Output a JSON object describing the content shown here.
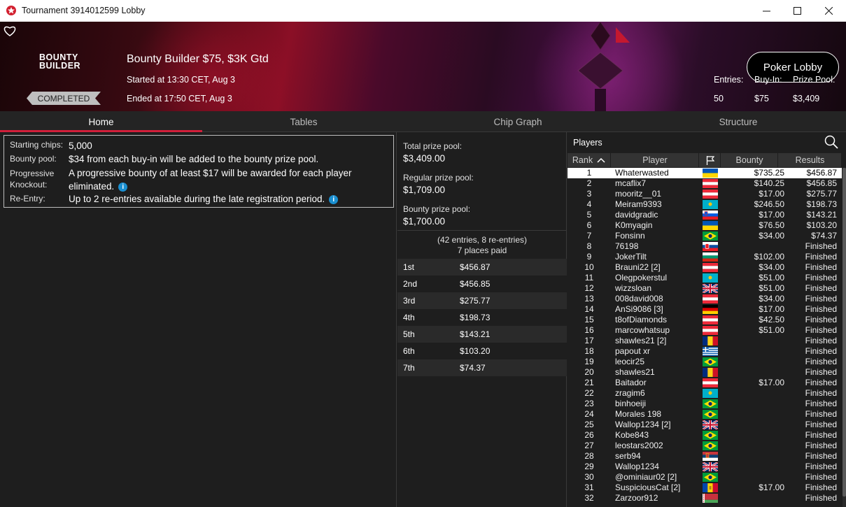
{
  "window": {
    "title": "Tournament 3914012599 Lobby"
  },
  "header": {
    "brand": "BOUNTY BUILDER",
    "name": "Bounty Builder $75, $3K Gtd",
    "started": "Started at 13:30 CET, Aug 3",
    "ended": "Ended at 17:50 CET, Aug 3",
    "status": "COMPLETED",
    "lobby_button": "Poker Lobby",
    "entries_label": "Entries:",
    "entries": "50",
    "buyin_label": "Buy-In:",
    "buyin": "$75",
    "pool_label": "Prize Pool:",
    "pool": "$3,409"
  },
  "tabs": [
    {
      "label": "Home"
    },
    {
      "label": "Tables"
    },
    {
      "label": "Chip Graph"
    },
    {
      "label": "Structure"
    }
  ],
  "info": {
    "starting_label": "Starting chips:",
    "starting": "5,000",
    "bounty_label": "Bounty pool:",
    "bounty": "$34 from each buy-in will be added to the bounty prize pool.",
    "pko_label": "Progressive Knockout:",
    "pko": "A progressive bounty of at least $17 will be awarded for each player eliminated.",
    "reentry_label": "Re-Entry:",
    "reentry": "Up to 2 re-entries available during the late registration period."
  },
  "prize": {
    "total_label": "Total prize pool:",
    "total": "$3,409.00",
    "regular_label": "Regular prize pool:",
    "regular": "$1,709.00",
    "bounty_label": "Bounty prize pool:",
    "bounty": "$1,700.00",
    "entries_note": "(42 entries, 8 re-entries)",
    "paid_note": "7 places paid",
    "places": [
      {
        "p": "1st",
        "a": "$456.87"
      },
      {
        "p": "2nd",
        "a": "$456.85"
      },
      {
        "p": "3rd",
        "a": "$275.77"
      },
      {
        "p": "4th",
        "a": "$198.73"
      },
      {
        "p": "5th",
        "a": "$143.21"
      },
      {
        "p": "6th",
        "a": "$103.20"
      },
      {
        "p": "7th",
        "a": "$74.37"
      }
    ]
  },
  "players": {
    "title": "Players",
    "columns": [
      "Rank",
      "Player",
      "Bounty",
      "Results"
    ],
    "rows": [
      {
        "rank": "1",
        "name": "Whaterwasted",
        "flag": "ukraine",
        "bounty": "$735.25",
        "result": "$456.87"
      },
      {
        "rank": "2",
        "name": "mcaflix7",
        "flag": "austria",
        "bounty": "$140.25",
        "result": "$456.85"
      },
      {
        "rank": "3",
        "name": "mooritz__01",
        "flag": "austria",
        "bounty": "$17.00",
        "result": "$275.77"
      },
      {
        "rank": "4",
        "name": "Meiram9393",
        "flag": "kazakhstan",
        "bounty": "$246.50",
        "result": "$198.73"
      },
      {
        "rank": "5",
        "name": "davidgradic",
        "flag": "slovenia",
        "bounty": "$17.00",
        "result": "$143.21"
      },
      {
        "rank": "6",
        "name": "K0myagin",
        "flag": "ukraine",
        "bounty": "$76.50",
        "result": "$103.20"
      },
      {
        "rank": "7",
        "name": "Fonsinn",
        "flag": "brazil",
        "bounty": "$34.00",
        "result": "$74.37"
      },
      {
        "rank": "8",
        "name": "76198",
        "flag": "slovakia",
        "bounty": "",
        "result": "Finished"
      },
      {
        "rank": "9",
        "name": "JokerTilt",
        "flag": "bulgaria",
        "bounty": "$102.00",
        "result": "Finished"
      },
      {
        "rank": "10",
        "name": "Brauni22 [2]",
        "flag": "austria",
        "bounty": "$34.00",
        "result": "Finished"
      },
      {
        "rank": "11",
        "name": "Olegpokerstul",
        "flag": "kazakhstan",
        "bounty": "$51.00",
        "result": "Finished"
      },
      {
        "rank": "12",
        "name": "wizzsloan",
        "flag": "uk",
        "bounty": "$51.00",
        "result": "Finished"
      },
      {
        "rank": "13",
        "name": "008david008",
        "flag": "austria",
        "bounty": "$34.00",
        "result": "Finished"
      },
      {
        "rank": "14",
        "name": "AnSi9086 [3]",
        "flag": "germany",
        "bounty": "$17.00",
        "result": "Finished"
      },
      {
        "rank": "15",
        "name": "t8ofDiamonds",
        "flag": "austria",
        "bounty": "$42.50",
        "result": "Finished"
      },
      {
        "rank": "16",
        "name": "marcowhatsup",
        "flag": "austria",
        "bounty": "$51.00",
        "result": "Finished"
      },
      {
        "rank": "17",
        "name": "shawles21 [2]",
        "flag": "romania",
        "bounty": "",
        "result": "Finished"
      },
      {
        "rank": "18",
        "name": "papout xr",
        "flag": "greece",
        "bounty": "",
        "result": "Finished"
      },
      {
        "rank": "19",
        "name": "leocir25",
        "flag": "brazil",
        "bounty": "",
        "result": "Finished"
      },
      {
        "rank": "20",
        "name": "shawles21",
        "flag": "romania",
        "bounty": "",
        "result": "Finished"
      },
      {
        "rank": "21",
        "name": "Baitador",
        "flag": "austria",
        "bounty": "$17.00",
        "result": "Finished"
      },
      {
        "rank": "22",
        "name": "zragim6",
        "flag": "kazakhstan",
        "bounty": "",
        "result": "Finished"
      },
      {
        "rank": "23",
        "name": "binhoeiji",
        "flag": "brazil",
        "bounty": "",
        "result": "Finished"
      },
      {
        "rank": "24",
        "name": "Morales 198",
        "flag": "brazil",
        "bounty": "",
        "result": "Finished"
      },
      {
        "rank": "25",
        "name": "Wallop1234 [2]",
        "flag": "uk",
        "bounty": "",
        "result": "Finished"
      },
      {
        "rank": "26",
        "name": "Kobe843",
        "flag": "brazil",
        "bounty": "",
        "result": "Finished"
      },
      {
        "rank": "27",
        "name": "leostars2002",
        "flag": "brazil",
        "bounty": "",
        "result": "Finished"
      },
      {
        "rank": "28",
        "name": "serb94",
        "flag": "serbia",
        "bounty": "",
        "result": "Finished"
      },
      {
        "rank": "29",
        "name": "Wallop1234",
        "flag": "uk",
        "bounty": "",
        "result": "Finished"
      },
      {
        "rank": "30",
        "name": "@ominiaur02 [2]",
        "flag": "brazil",
        "bounty": "",
        "result": "Finished"
      },
      {
        "rank": "31",
        "name": "SuspiciousCat [2]",
        "flag": "moldova",
        "bounty": "$17.00",
        "result": "Finished"
      },
      {
        "rank": "32",
        "name": "Zarzoor912",
        "flag": "belarus",
        "bounty": "",
        "result": "Finished"
      }
    ]
  }
}
